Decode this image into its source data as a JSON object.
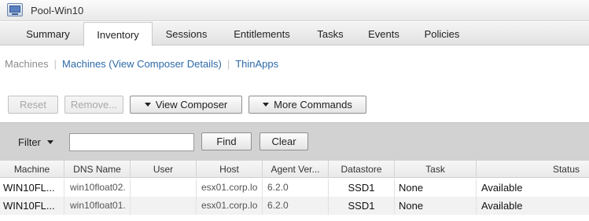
{
  "window": {
    "title": "Pool-Win10",
    "icon": "desktop-pool-icon"
  },
  "tabs": [
    {
      "label": "Summary",
      "active": false
    },
    {
      "label": "Inventory",
      "active": true
    },
    {
      "label": "Sessions",
      "active": false
    },
    {
      "label": "Entitlements",
      "active": false
    },
    {
      "label": "Tasks",
      "active": false
    },
    {
      "label": "Events",
      "active": false
    },
    {
      "label": "Policies",
      "active": false
    }
  ],
  "subnav": {
    "machines": "Machines",
    "composer_details": "Machines (View Composer Details)",
    "thinapps": "ThinApps",
    "separator": "|"
  },
  "toolbar": {
    "reset": "Reset",
    "remove": "Remove...",
    "view_composer": "View Composer",
    "more_commands": "More Commands"
  },
  "filter": {
    "label": "Filter",
    "input_value": "",
    "find": "Find",
    "clear": "Clear"
  },
  "table": {
    "columns": [
      "Machine",
      "DNS Name",
      "User",
      "Host",
      "Agent Ver...",
      "Datastore",
      "Task",
      "Status"
    ],
    "rows": [
      {
        "machine": "WIN10FL...",
        "dns": "win10float02.",
        "user": "",
        "host": "esx01.corp.lo",
        "agent": "6.2.0",
        "datastore": "SSD1",
        "task": "None",
        "status": "Available"
      },
      {
        "machine": "WIN10FL...",
        "dns": "win10float01.",
        "user": "",
        "host": "esx01.corp.lo",
        "agent": "6.2.0",
        "datastore": "SSD1",
        "task": "None",
        "status": "Available"
      }
    ]
  }
}
